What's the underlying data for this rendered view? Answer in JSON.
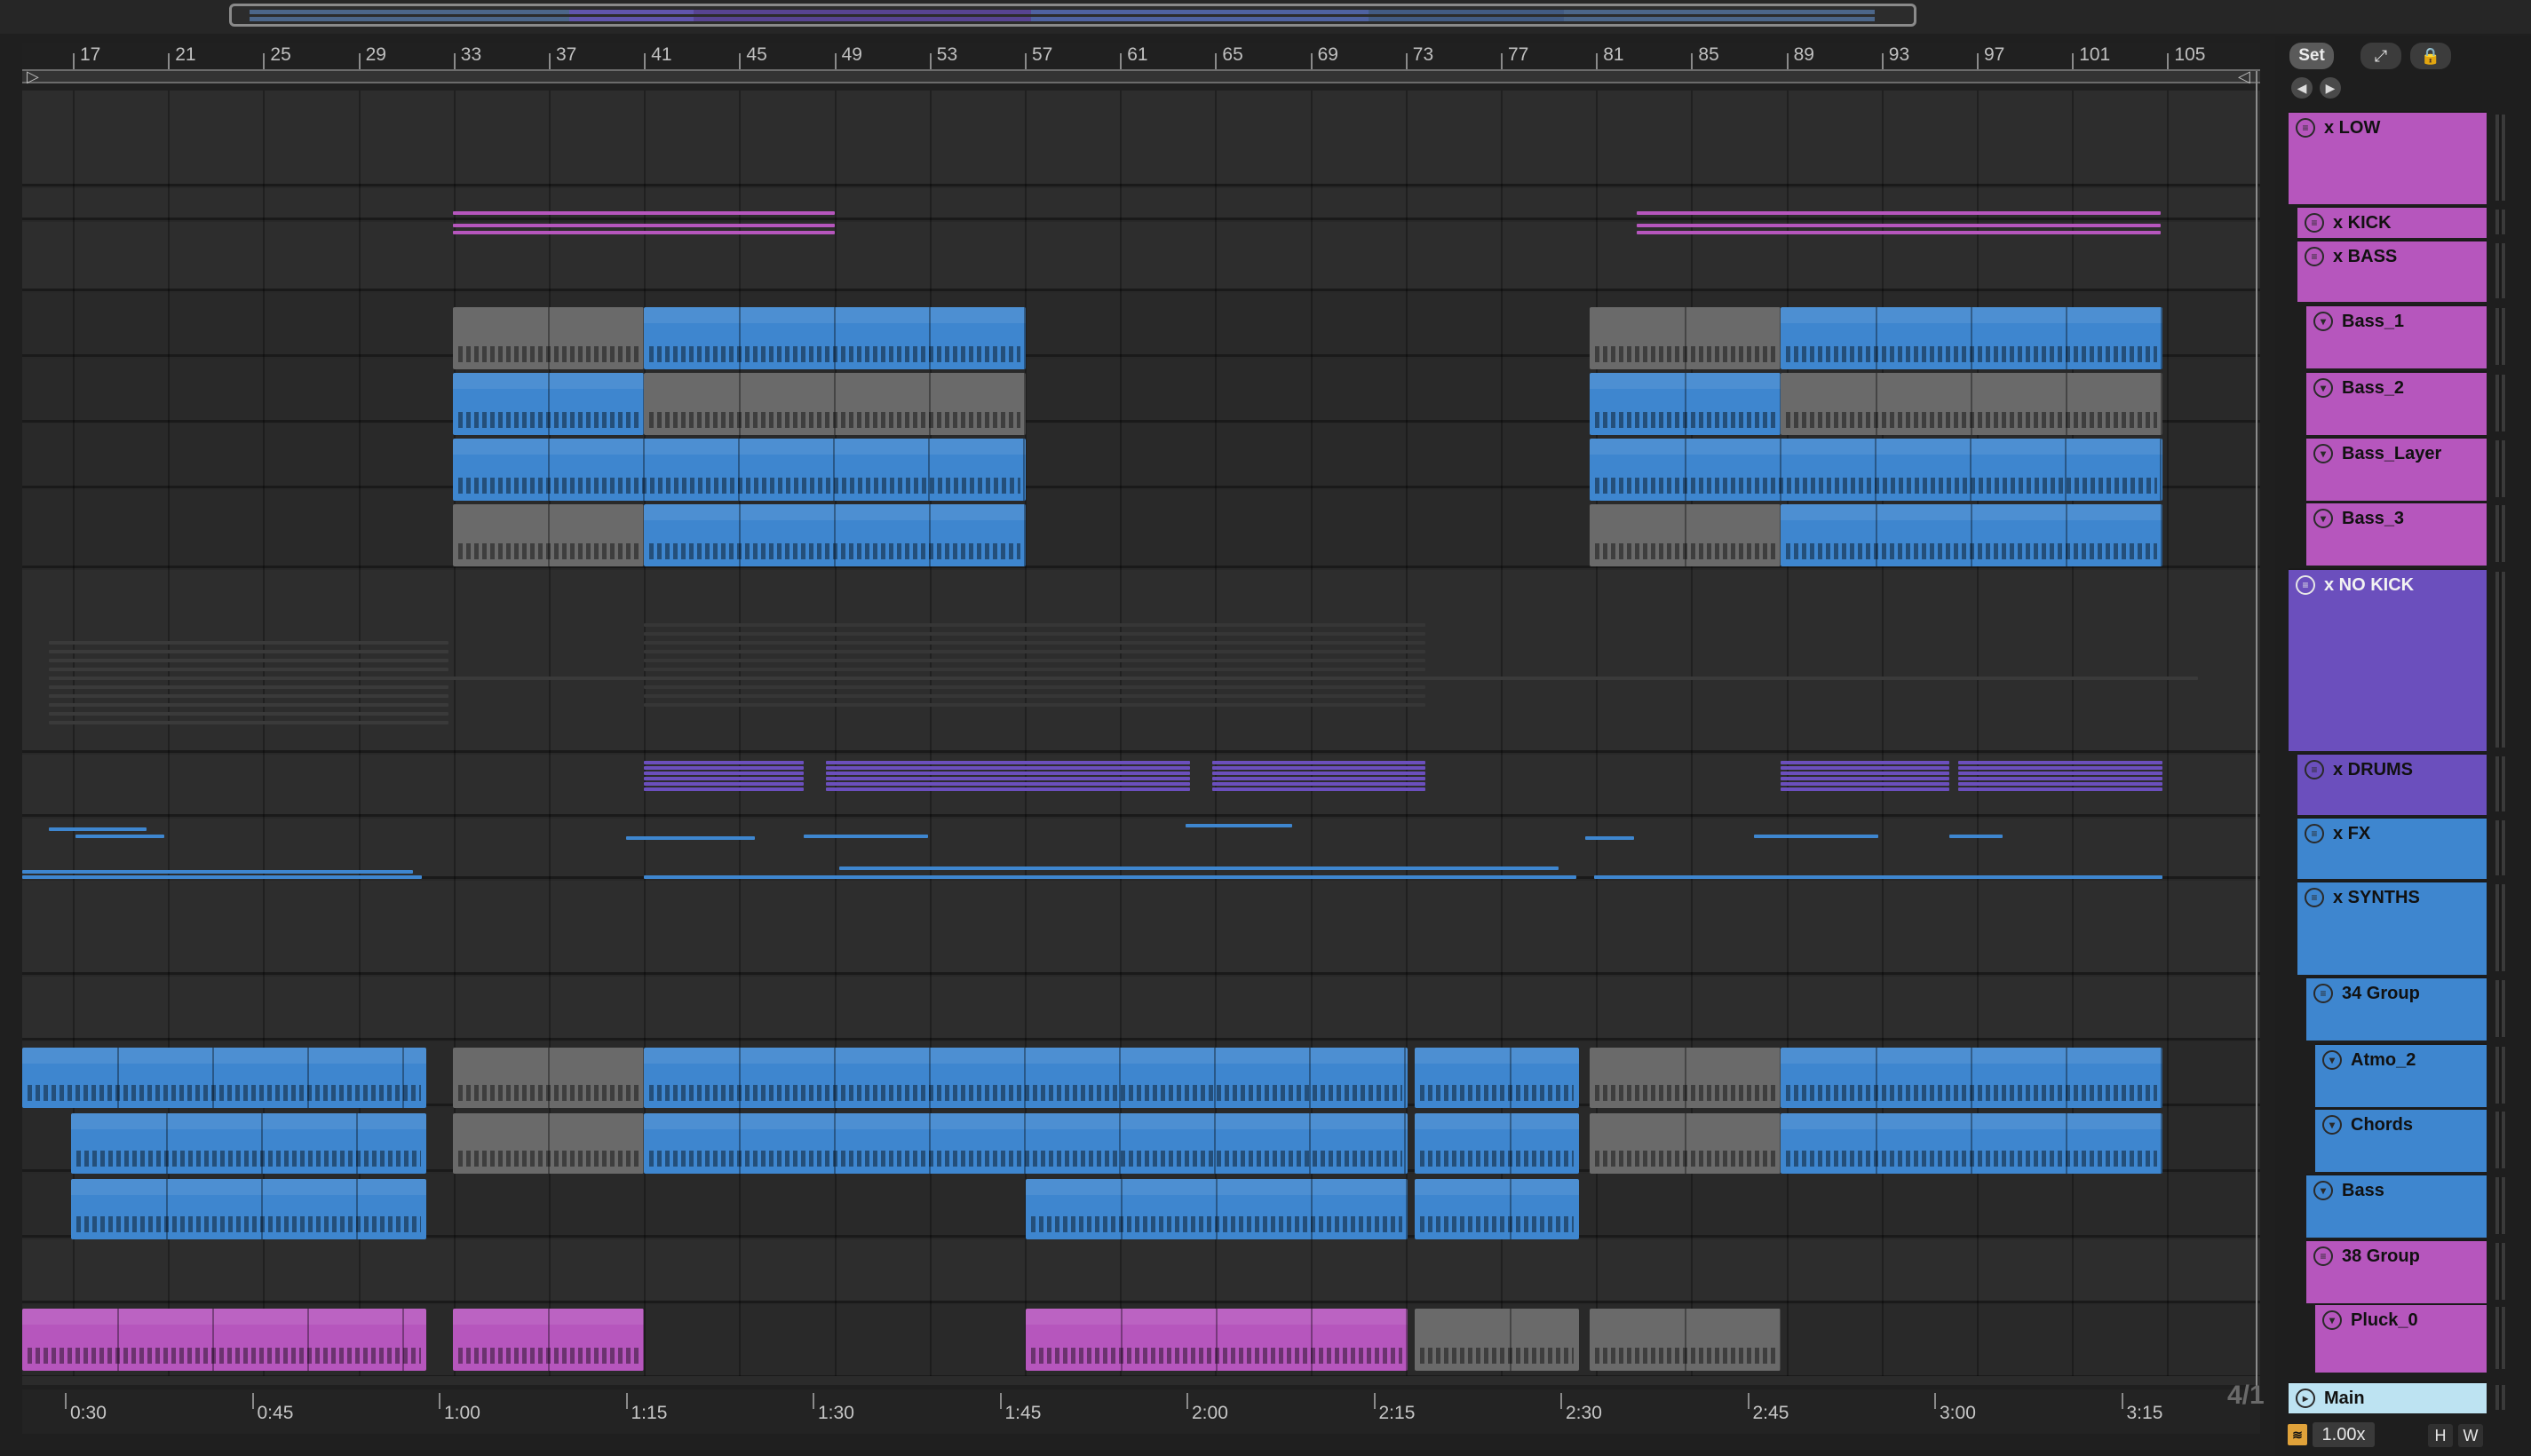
{
  "overview": {
    "label": "Arrangement overview"
  },
  "bar_ruler": {
    "numbers": [
      "17",
      "21",
      "25",
      "29",
      "33",
      "37",
      "41",
      "45",
      "49",
      "53",
      "57",
      "61",
      "65",
      "69",
      "73",
      "77",
      "81",
      "85",
      "89",
      "93",
      "97",
      "101",
      "105"
    ]
  },
  "time_ruler": {
    "labels": [
      "0:30",
      "0:45",
      "1:00",
      "1:15",
      "1:30",
      "1:45",
      "2:00",
      "2:15",
      "2:30",
      "2:45",
      "3:00",
      "3:15"
    ]
  },
  "time_signature": "4/1",
  "toolbar": {
    "set_label": "Set",
    "expand_icon": "⤢",
    "lock_icon": "🔒",
    "back_icon": "◀",
    "forward_icon": "▶"
  },
  "zoom": {
    "value": "1.00x",
    "icon": "waveform-zoom-icon"
  },
  "hw": {
    "h": "H",
    "w": "W"
  },
  "colors": {
    "purple": "#b656bd",
    "violet": "#6b4fbd",
    "blue": "#3e86cf",
    "gray": "#6a6a6a",
    "light_blue": "#bde3f2"
  },
  "tracks": [
    {
      "name": "x LOW",
      "kind": "group"
    },
    {
      "name": "x KICK",
      "kind": "group"
    },
    {
      "name": "x BASS",
      "kind": "group"
    },
    {
      "name": "Bass_1",
      "kind": "midi"
    },
    {
      "name": "Bass_2",
      "kind": "midi"
    },
    {
      "name": "Bass_Layer",
      "kind": "midi"
    },
    {
      "name": "Bass_3",
      "kind": "midi"
    },
    {
      "name": "x NO KICK",
      "kind": "group"
    },
    {
      "name": "x DRUMS",
      "kind": "group"
    },
    {
      "name": "x FX",
      "kind": "group"
    },
    {
      "name": "x SYNTHS",
      "kind": "group"
    },
    {
      "name": "34 Group",
      "kind": "group"
    },
    {
      "name": "Atmo_2",
      "kind": "midi"
    },
    {
      "name": "Chords",
      "kind": "midi"
    },
    {
      "name": "Bass",
      "kind": "midi"
    },
    {
      "name": "38 Group",
      "kind": "group"
    },
    {
      "name": "Pluck_0",
      "kind": "midi"
    },
    {
      "name": "Main",
      "kind": "main"
    }
  ]
}
